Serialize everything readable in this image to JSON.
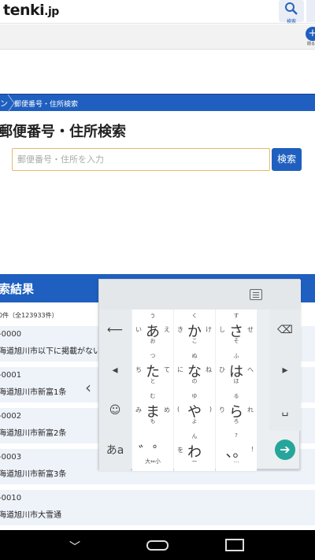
{
  "header": {
    "logo_main": "tenki",
    "logo_suffix": ".jp",
    "search_label": "検索"
  },
  "subbar": {
    "side_label": "閉る"
  },
  "breadcrumb": {
    "home": "ン",
    "current": "郵便番号・住所検索"
  },
  "page_title": "郵便番号・住所検索",
  "search": {
    "placeholder": "郵便番号・住所を入力",
    "button_label": "検索"
  },
  "results": {
    "title": "索結果",
    "count": "0件（全123933件）",
    "rows": [
      {
        "code": "-0000",
        "address": "海道旭川市以下に掲載がない"
      },
      {
        "code": "-0001",
        "address": "海道旭川市新富1条"
      },
      {
        "code": "-0002",
        "address": "海道旭川市新富2条"
      },
      {
        "code": "-0003",
        "address": "海道旭川市新富3条"
      },
      {
        "code": "-0010",
        "address": "海道旭川市大雪通"
      }
    ]
  },
  "keyboard": {
    "keys": [
      {
        "main": "あ",
        "top": "う",
        "bottom": "お",
        "left": "い",
        "right": "え"
      },
      {
        "main": "か",
        "top": "く",
        "bottom": "こ",
        "left": "き",
        "right": "け"
      },
      {
        "main": "さ",
        "top": "す",
        "bottom": "そ",
        "left": "し",
        "right": "せ"
      },
      {
        "main": "た",
        "top": "つ",
        "bottom": "と",
        "left": "ち",
        "right": "て"
      },
      {
        "main": "な",
        "top": "ぬ",
        "bottom": "の",
        "left": "に",
        "right": "ね"
      },
      {
        "main": "は",
        "top": "ふ",
        "bottom": "ほ",
        "left": "ひ",
        "right": "へ"
      },
      {
        "main": "ま",
        "top": "む",
        "bottom": "も",
        "left": "み",
        "right": "め"
      },
      {
        "main": "や",
        "top": "ゆ",
        "bottom": "よ",
        "left": "(",
        "right": ")"
      },
      {
        "main": "ら",
        "top": "る",
        "bottom": "ろ",
        "left": "り",
        "right": "れ"
      },
      {
        "main": "゛゜",
        "top": "",
        "bottom": "大⇔小",
        "left": "",
        "right": ""
      },
      {
        "main": "わ",
        "top": "ん",
        "bottom": "ー",
        "left": "を",
        "right": ""
      },
      {
        "main": "、。",
        "top": "?",
        "bottom": "…",
        "left": "",
        "right": "!"
      }
    ],
    "side_left": [
      "⟵",
      "◂",
      "☺123",
      "あa"
    ],
    "side_right": [
      "⌫",
      "▸",
      "␣",
      ""
    ],
    "enter": "➔",
    "backspace_icon": "backspace-icon"
  },
  "nav": {
    "back": "﹀"
  }
}
